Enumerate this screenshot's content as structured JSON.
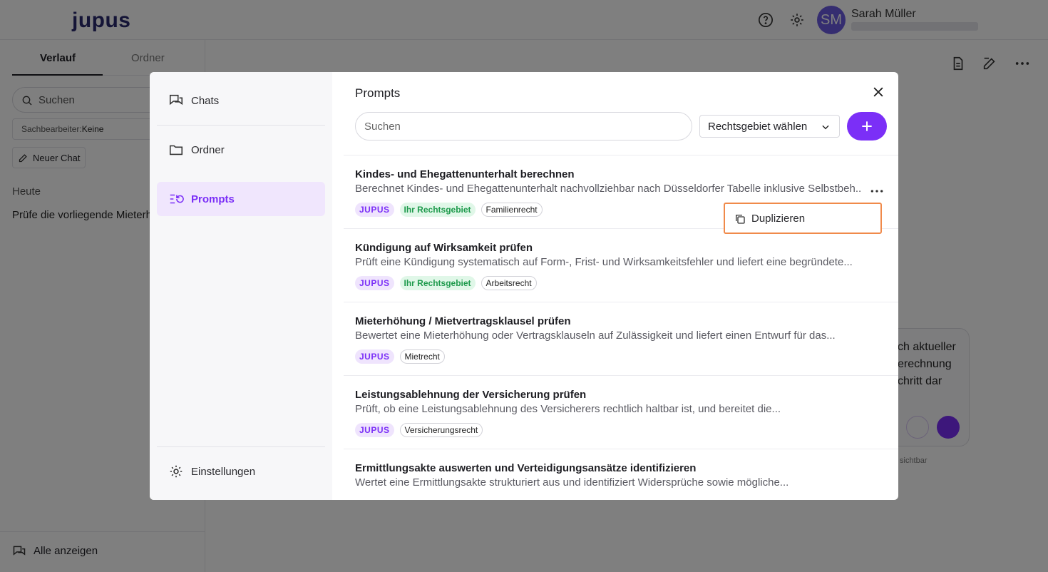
{
  "app": {
    "logo": "jupus"
  },
  "user": {
    "initials": "SM",
    "name": "Sarah Müller"
  },
  "sidebar": {
    "tabs": [
      {
        "label": "Verlauf"
      },
      {
        "label": "Ordner"
      }
    ],
    "search_placeholder": "Suchen",
    "filter_label": "Sachbearbeiter:",
    "filter_value": "Keine",
    "new_chat_label": "Neuer Chat",
    "section_today": "Heute",
    "chat_item": "Prüfe die vorliegende Mieterh",
    "show_all_label": "Alle anzeigen"
  },
  "chat": {
    "bubble_lines": [
      "ch aktueller",
      "erechnung",
      "chritt dar"
    ],
    "visible_note": "sichtbar"
  },
  "modal": {
    "nav": {
      "chats": "Chats",
      "ordner": "Ordner",
      "prompts": "Prompts",
      "settings": "Einstellungen"
    },
    "title": "Prompts",
    "search_placeholder": "Suchen",
    "area_select_label": "Rechtsgebiet wählen",
    "prompts": [
      {
        "title": "Kindes- und Ehegattenunterhalt berechnen",
        "description": "Berechnet Kindes- und Ehegattenunterhalt nachvollziehbar nach Düsseldorfer Tabelle inklusive Selbstbeh...",
        "source_tag": "JUPUS",
        "own_area_tag": "Ihr Rechtsgebiet",
        "area_tag": "Familienrecht"
      },
      {
        "title": "Kündigung auf Wirksamkeit prüfen",
        "description": "Prüft eine Kündigung systematisch auf Form-, Frist- und Wirksamkeitsfehler und liefert eine begründete...",
        "source_tag": "JUPUS",
        "own_area_tag": "Ihr Rechtsgebiet",
        "area_tag": "Arbeitsrecht"
      },
      {
        "title": "Mieterhöhung / Mietvertragsklausel prüfen",
        "description": "Bewertet eine Mieterhöhung oder Vertragsklauseln auf Zulässigkeit und liefert einen Entwurf für das...",
        "source_tag": "JUPUS",
        "area_tag": "Mietrecht"
      },
      {
        "title": "Leistungsablehnung der Versicherung prüfen",
        "description": "Prüft, ob eine Leistungsablehnung des Versicherers rechtlich haltbar ist, und bereitet die...",
        "source_tag": "JUPUS",
        "area_tag": "Versicherungsrecht"
      },
      {
        "title": "Ermittlungsakte auswerten und Verteidigungsansätze identifizieren",
        "description": "Wertet eine Ermittlungsakte strukturiert aus und identifiziert Widersprüche sowie mögliche..."
      }
    ],
    "context_menu": {
      "duplicate_label": "Duplizieren"
    }
  },
  "colors": {
    "accent": "#7b2ff7",
    "accent_light": "#f0e6fd",
    "own_area_green": "#1e9a4c",
    "highlight_border": "#f08a4a"
  }
}
